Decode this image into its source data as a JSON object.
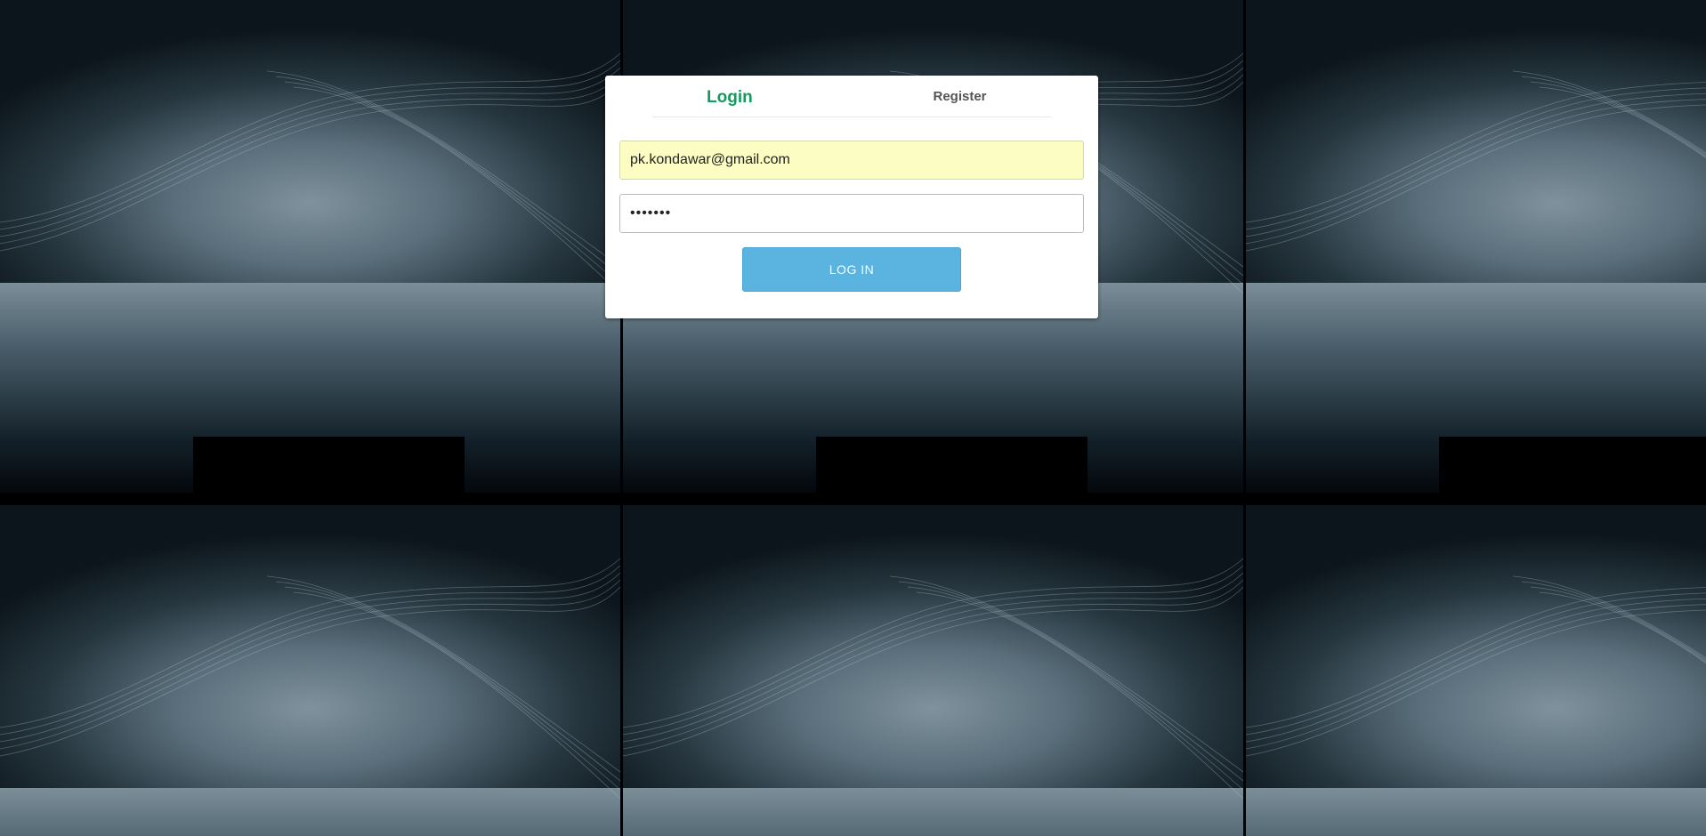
{
  "tabs": {
    "login_label": "Login",
    "register_label": "Register",
    "active": "login",
    "active_color": "#139a5e"
  },
  "form": {
    "email_value": "pk.kondawar@gmail.com",
    "password_value": "•••••••",
    "submit_label": "LOG IN",
    "submit_color": "#5bb3e0",
    "autofill_color": "#fbfdc2"
  },
  "background": {
    "pattern": "tiled-wave-swirl",
    "base_color": "#0b1218",
    "highlight_color": "#7a8d98"
  }
}
